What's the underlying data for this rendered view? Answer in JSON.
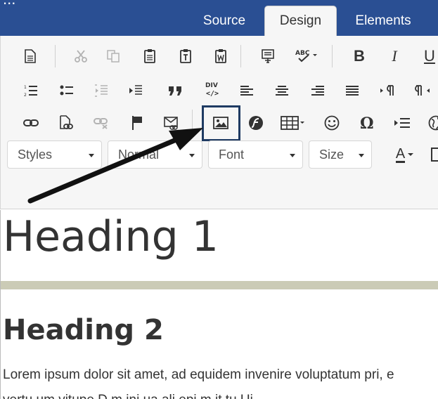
{
  "topbar": {
    "partial_title": "...",
    "tabs": [
      {
        "label": "Source",
        "active": false
      },
      {
        "label": "Design",
        "active": true
      },
      {
        "label": "Elements",
        "active": false
      }
    ]
  },
  "toolbar": {
    "bold": "B",
    "italic": "I",
    "underline": "U",
    "combos": {
      "styles": "Styles",
      "format": "Normal",
      "font": "Font",
      "size": "Size"
    },
    "text_color_label": "A"
  },
  "content": {
    "heading1": "Heading 1",
    "heading2": "Heading 2",
    "paragraph_line1": "Lorem ipsum dolor sit amet, ad equidem invenire voluptatum pri, e",
    "paragraph_line2": "vertu  um  vitupe    D   m    ini    ua   ali   epi    m  it  tu  Ui"
  },
  "colors": {
    "topbar": "#2a4f93",
    "toolbar_bg": "#f6f6f6",
    "highlight": "#1f3b63",
    "rule": "#cbcbb6"
  }
}
